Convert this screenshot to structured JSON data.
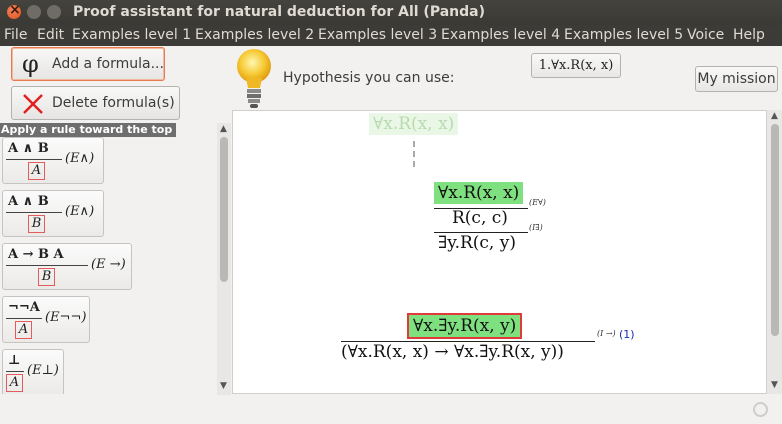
{
  "window": {
    "title": "Proof assistant for natural deduction for All (Panda)"
  },
  "menu": [
    "File",
    "Edit",
    "Examples level 1",
    "Examples level 2",
    "Examples level 3",
    "Examples level 4",
    "Examples level 5",
    "Voice",
    "Help"
  ],
  "toolbar": {
    "add_label": "Add a formula...",
    "add_icon_glyph": "φ",
    "delete_label": "Delete formula(s)",
    "hypothesis_label": "Hypothesis you can use:",
    "hypothesis_chip": "1.∀x.R(x, x)",
    "mission_label": "My mission"
  },
  "rules": {
    "header": "Apply a rule toward the top",
    "items": [
      {
        "premise": "A ∧ B",
        "conclusion": "A",
        "name": "(E∧)"
      },
      {
        "premise": "A ∧ B",
        "conclusion": "B",
        "name": "(E∧)"
      },
      {
        "premise": "A → B   A",
        "conclusion": "B",
        "name": "(E →)"
      },
      {
        "premise": "¬¬A",
        "conclusion": "A",
        "name": "(E¬¬)"
      },
      {
        "premise": "⊥",
        "conclusion": "A",
        "name": "(E⊥)"
      }
    ]
  },
  "proof": {
    "ghost_formula": "∀x.R(x, x)",
    "hyp_formula": "∀x.R(x, x)",
    "hyp_rule": "(E∀)",
    "mid_formula": "R(c, c)",
    "mid_rule": "(I∃)",
    "bottom_formula": "∃y.R(c, y)",
    "goal_formula": "∀x.∃y.R(x, y)",
    "goal_rule": "(I →)",
    "goal_ref": "(1)",
    "final_formula": "(∀x.R(x, x) → ∀x.∃y.R(x, y))"
  },
  "colors": {
    "highlight_green": "#7ee07e",
    "goal_border": "#e03a3a",
    "titlebar": "#3c3b37"
  }
}
